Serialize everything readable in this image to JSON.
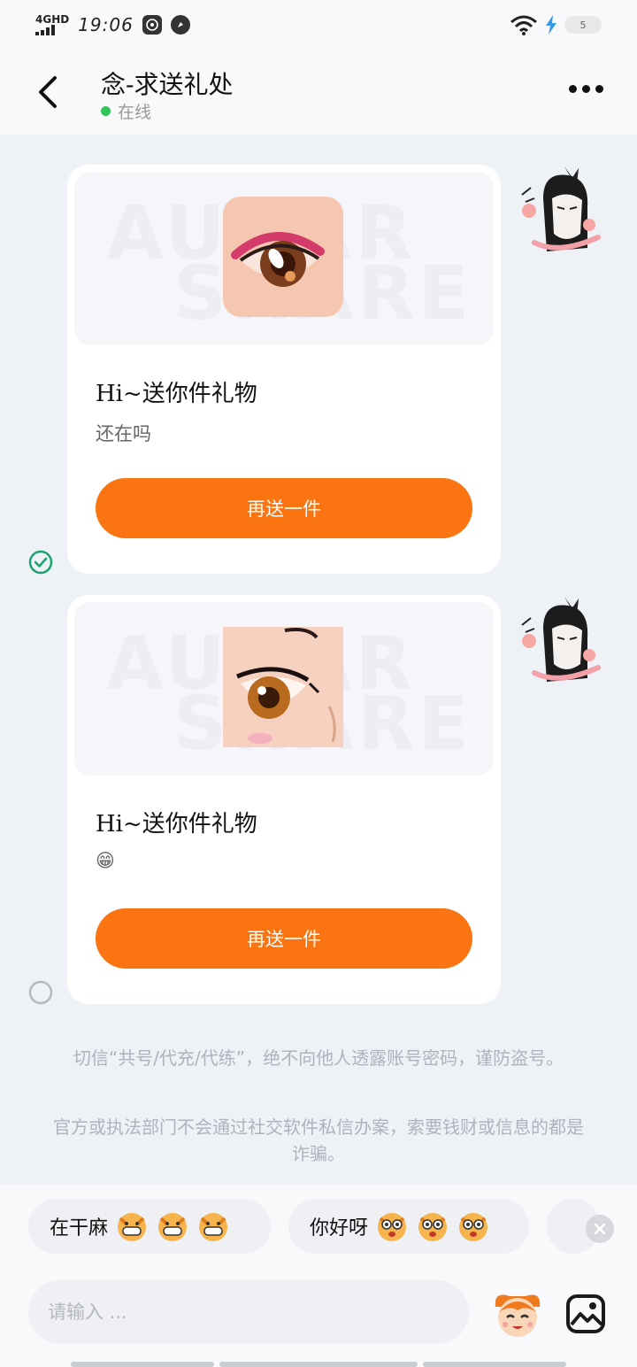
{
  "status_bar": {
    "network": "4GHD",
    "time": "19:06",
    "battery": "5"
  },
  "header": {
    "title": "念-求送礼处",
    "presence": "在线"
  },
  "messages": [
    {
      "title": "Hi~送你件礼物",
      "subtitle": "还在吗",
      "button": "再送一件",
      "watermark_line1": "AUDAR",
      "watermark_line2": "SHARE"
    },
    {
      "title": "Hi~送你件礼物",
      "subtitle": "😁",
      "button": "再送一件",
      "watermark_line1": "AUDAR",
      "watermark_line2": "SHARE"
    }
  ],
  "notices": [
    "切信“共号/代充/代练”，绝不向他人透露账号密码，谨防盗号。",
    "官方或执法部门不会通过社交软件私信办案，索要钱财或信息的都是诈骗。"
  ],
  "quick_replies": [
    {
      "text": "在干麻"
    },
    {
      "text": "你好呀"
    }
  ],
  "composer": {
    "placeholder": "请输入 ..."
  },
  "colors": {
    "accent": "#fa7411",
    "online": "#2fc55a",
    "check": "#1aa36f"
  }
}
